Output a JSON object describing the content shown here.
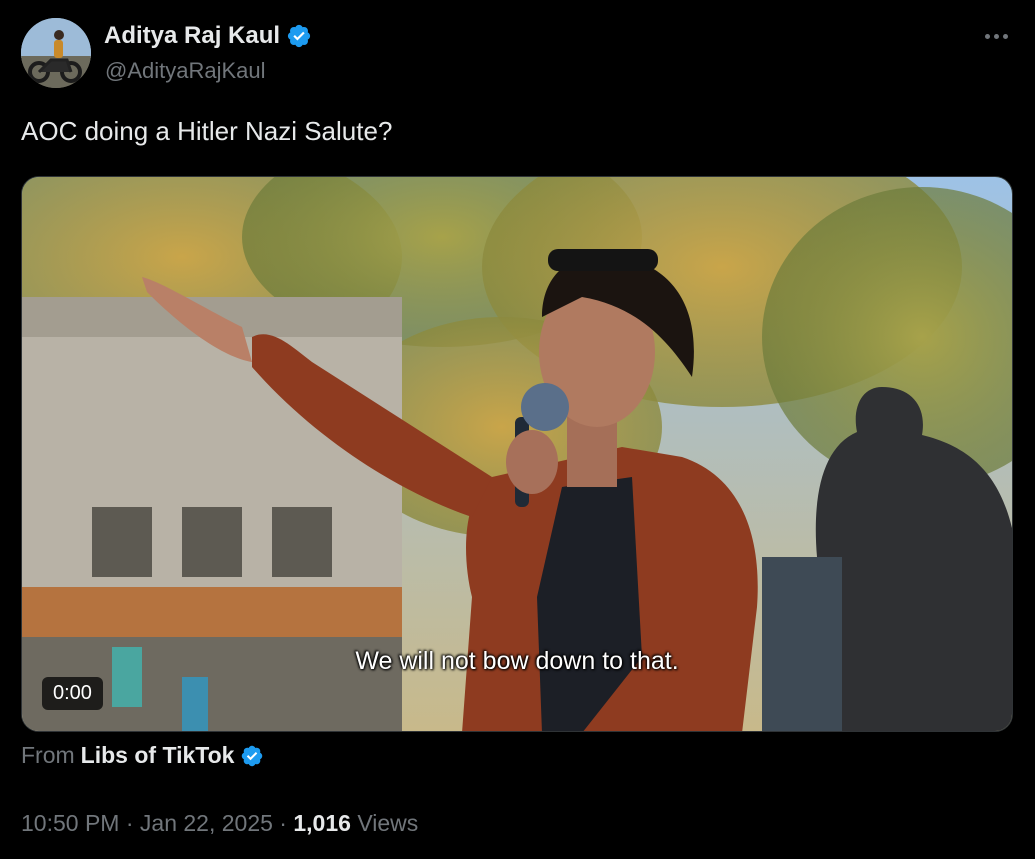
{
  "author": {
    "display_name": "Aditya Raj Kaul",
    "handle": "@AdityaRajKaul",
    "verified": true
  },
  "tweet": {
    "text": "AOC doing a Hitler Nazi Salute?"
  },
  "media": {
    "caption": "We will not bow down to that.",
    "timer": "0:00"
  },
  "source": {
    "from_label": "From",
    "name": "Libs of TikTok",
    "verified": true
  },
  "meta": {
    "time": "10:50 PM",
    "separator": " · ",
    "date": "Jan 22, 2025",
    "views_count": "1,016",
    "views_label": "Views"
  },
  "icons": {
    "verified": "verified-badge-icon",
    "more": "more-options-icon"
  },
  "colors": {
    "background": "#000000",
    "text": "#e7e9ea",
    "muted": "#71767b",
    "verified": "#1d9bf0"
  }
}
